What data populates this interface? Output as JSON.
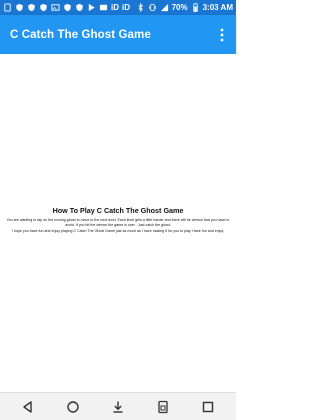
{
  "status_bar": {
    "left_icons": [
      "sim-icon",
      "shield-icon",
      "shield-icon",
      "shield-icon",
      "image-icon",
      "shield-icon",
      "shield-icon",
      "play-store-icon",
      "photo-icon"
    ],
    "id_labels": [
      "iD",
      "iD"
    ],
    "battery": "70%",
    "time": "3:03 AM",
    "right_icons": [
      "bluetooth-icon",
      "vibrate-icon",
      "signal-icon",
      "battery-icon"
    ]
  },
  "app_bar": {
    "title": "C Catch The Ghost Game",
    "menu_icon": "more-vert-icon"
  },
  "article": {
    "heading": "How To Play C Catch The Ghost Game",
    "paragraph_1": "You are wanting to tap on the moving ghost to move to the next level. Each level gets a little harder and there will be demon that you have to avoid. If you hit the demon the game is over . Just catch the ghost.",
    "paragraph_2": "I hope you have fun and enjoy playing C Catch The Ghost Game just as much as I have making it for you to play. Have fun and enjoy."
  },
  "nav_bar": {
    "buttons": [
      "back-icon",
      "home-icon",
      "download-icon",
      "sim-card-icon",
      "recents-icon"
    ]
  },
  "colors": {
    "status_bar": "#1976d2",
    "app_bar": "#2196f3",
    "background": "#ffffff",
    "nav_bar": "#f2f2f2"
  }
}
